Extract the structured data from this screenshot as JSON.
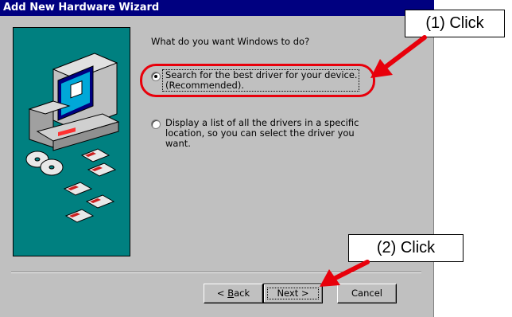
{
  "window": {
    "title": "Add New Hardware Wizard"
  },
  "main": {
    "prompt": "What do you want Windows to do?",
    "options": [
      {
        "label_line1": "Search for the best driver for your device.",
        "label_line2": "(Recommended).",
        "selected": true
      },
      {
        "label_line1": "Display a list of all the drivers in a specific",
        "label_line2": "location, so you can select the driver you want.",
        "selected": false
      }
    ]
  },
  "buttons": {
    "back_prefix": "< ",
    "back_accel": "B",
    "back_rest": "ack",
    "next": "Next >",
    "cancel": "Cancel"
  },
  "annotations": {
    "step1": "(1) Click",
    "step2": "(2) Click",
    "accent_color": "#e8000b"
  },
  "icons": [
    "computer-icon",
    "cd-disc-icon",
    "floppy-disk-icon"
  ]
}
